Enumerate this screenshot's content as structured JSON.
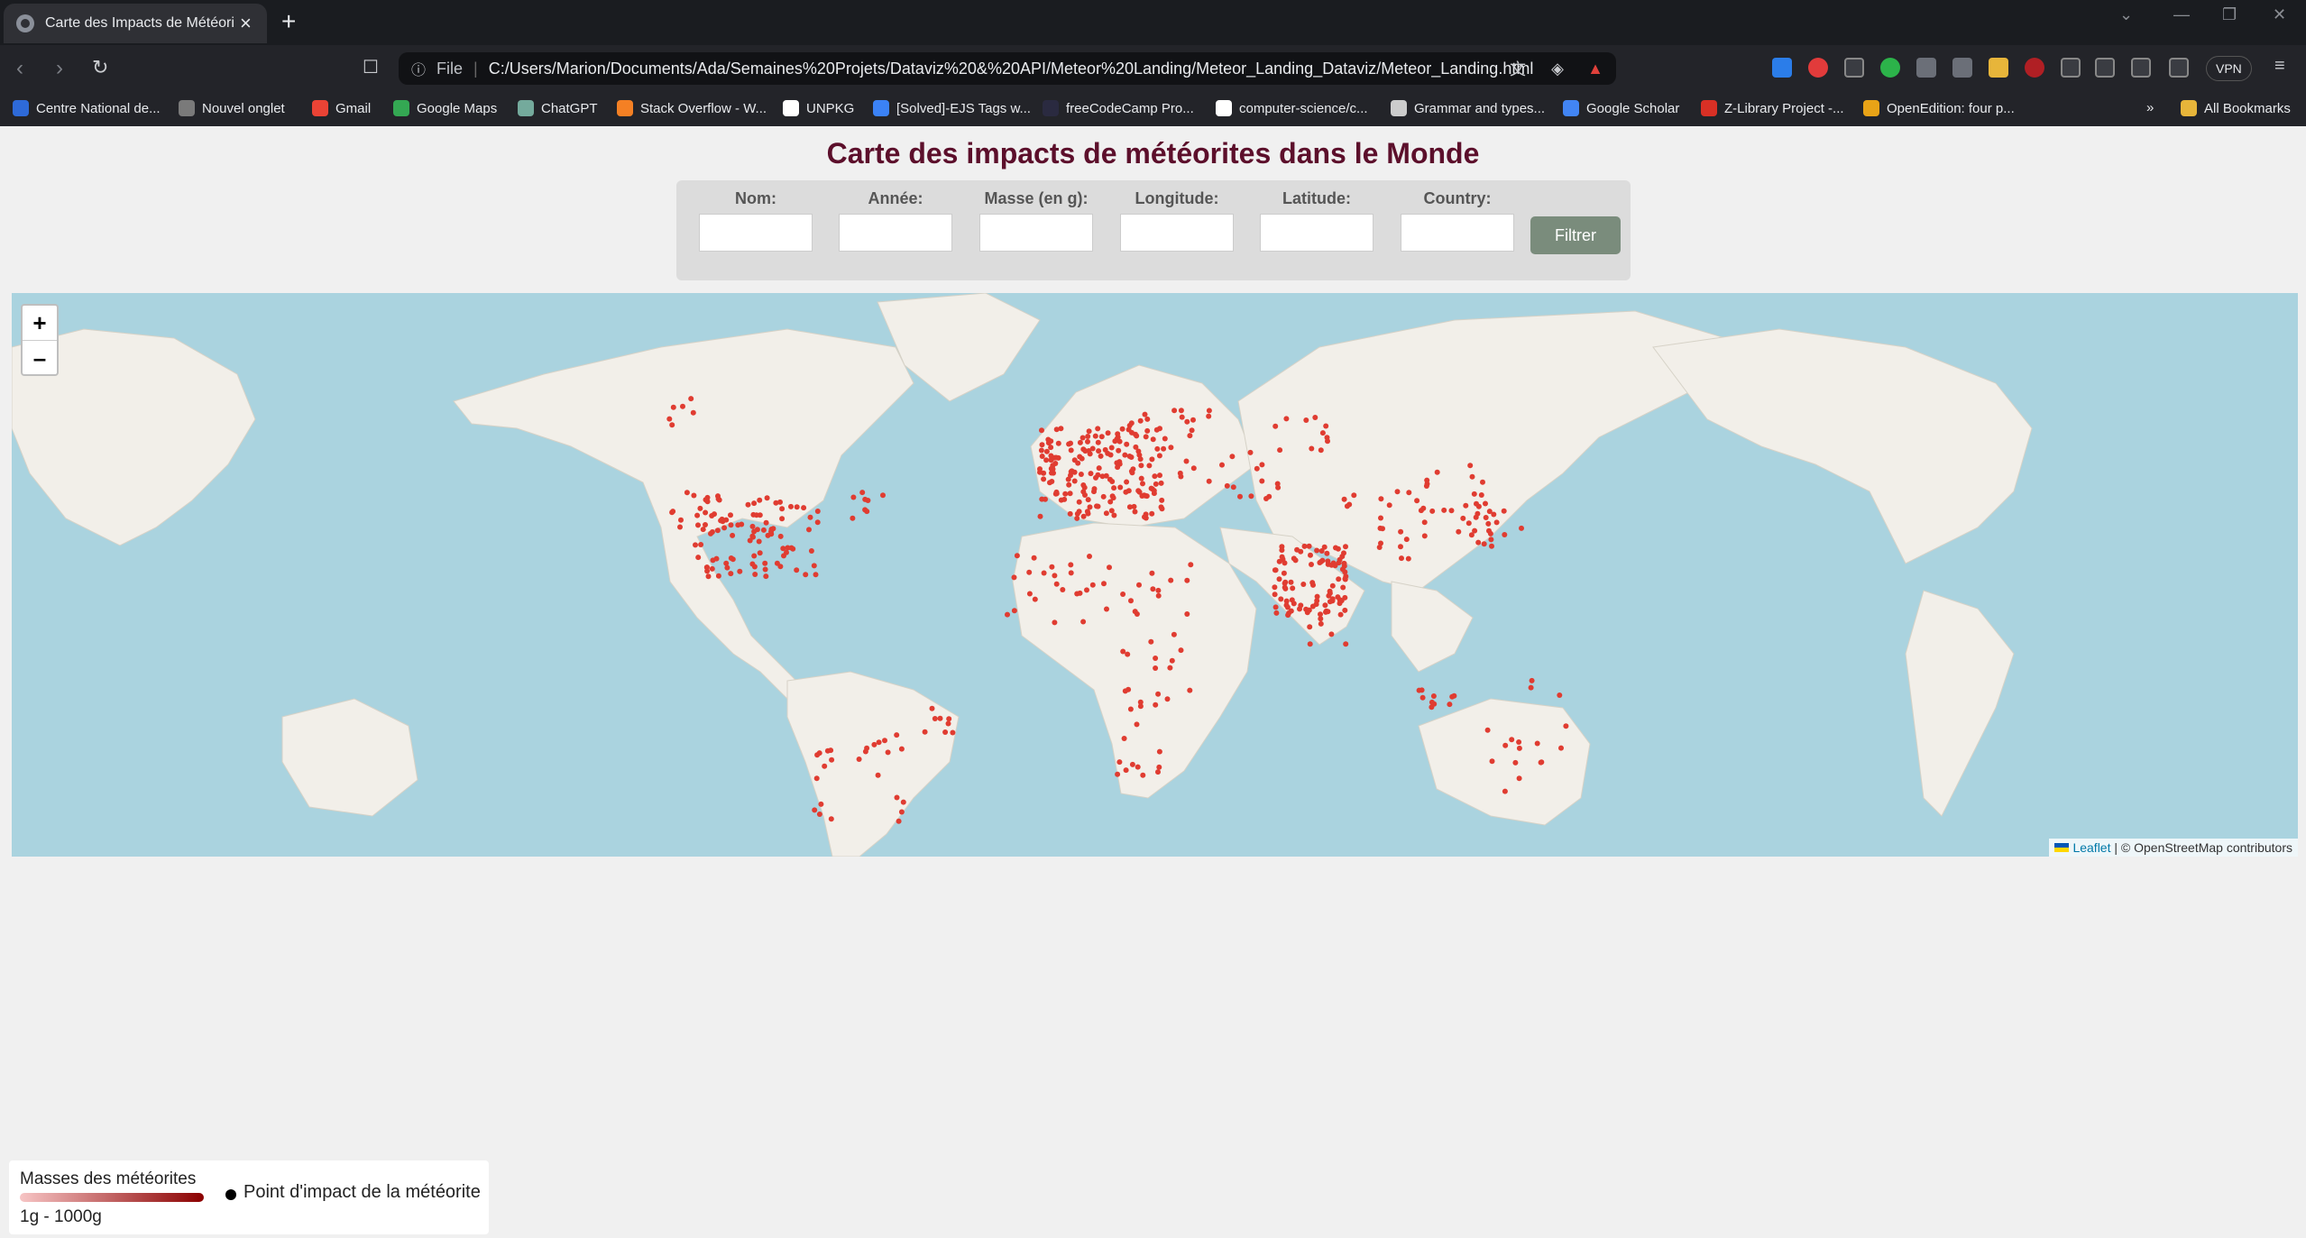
{
  "browser": {
    "tab_title": "Carte des Impacts de Météorites",
    "address_scheme": "File",
    "url": "C:/Users/Marion/Documents/Ada/Semaines%20Projets/Dataviz%20&%20API/Meteor%20Landing/Meteor_Landing_Dataviz/Meteor_Landing.html",
    "vpn_label": "VPN",
    "bookmarks": [
      {
        "label": "Centre National de...",
        "icon": "bookmark-favicon-icon",
        "color": "#2e6ad8"
      },
      {
        "label": "Nouvel onglet",
        "icon": "bookmark-favicon-icon",
        "color": "#7a7a7a"
      },
      {
        "label": "Gmail",
        "icon": "gmail-icon",
        "color": "#ea4335"
      },
      {
        "label": "Google Maps",
        "icon": "maps-pin-icon",
        "color": "#34a853"
      },
      {
        "label": "ChatGPT",
        "icon": "chatgpt-icon",
        "color": "#74aa9c"
      },
      {
        "label": "Stack Overflow - W...",
        "icon": "stackoverflow-icon",
        "color": "#f48024"
      },
      {
        "label": "UNPKG",
        "icon": "unpkg-icon",
        "color": "#ffffff"
      },
      {
        "label": "[Solved]-EJS Tags w...",
        "icon": "bookmark-favicon-icon",
        "color": "#3b82f6"
      },
      {
        "label": "freeCodeCamp Pro...",
        "icon": "freecodecamp-icon",
        "color": "#2a2a40"
      },
      {
        "label": "computer-science/c...",
        "icon": "github-icon",
        "color": "#ffffff"
      },
      {
        "label": "Grammar and types...",
        "icon": "mdn-icon",
        "color": "#cccccc"
      },
      {
        "label": "Google Scholar",
        "icon": "scholar-icon",
        "color": "#4285f4"
      },
      {
        "label": "Z-Library Project -...",
        "icon": "zlibrary-icon",
        "color": "#d93025"
      },
      {
        "label": "OpenEdition: four p...",
        "icon": "openedition-icon",
        "color": "#e8a317"
      }
    ],
    "all_bookmarks_label": "All Bookmarks",
    "more_bookmarks": "»"
  },
  "page": {
    "title": "Carte des impacts de météorites dans le Monde",
    "filters": [
      {
        "label": "Nom:",
        "value": ""
      },
      {
        "label": "Année:",
        "value": ""
      },
      {
        "label": "Masse (en g):",
        "value": ""
      },
      {
        "label": "Longitude:",
        "value": ""
      },
      {
        "label": "Latitude:",
        "value": ""
      },
      {
        "label": "Country:",
        "value": ""
      }
    ],
    "filter_button": "Filtrer"
  },
  "map": {
    "zoom_in": "+",
    "zoom_out": "–",
    "attribution_leaflet": "Leaflet",
    "attribution_rest": "| © OpenStreetMap contributors",
    "marker_color": "#e03c31",
    "land_color": "#f2efe9",
    "water_color": "#aad3df"
  },
  "legend": {
    "title": "Masses des météorites",
    "range": "1g - 1000g",
    "point_label": "Point d'impact de la météorite"
  }
}
